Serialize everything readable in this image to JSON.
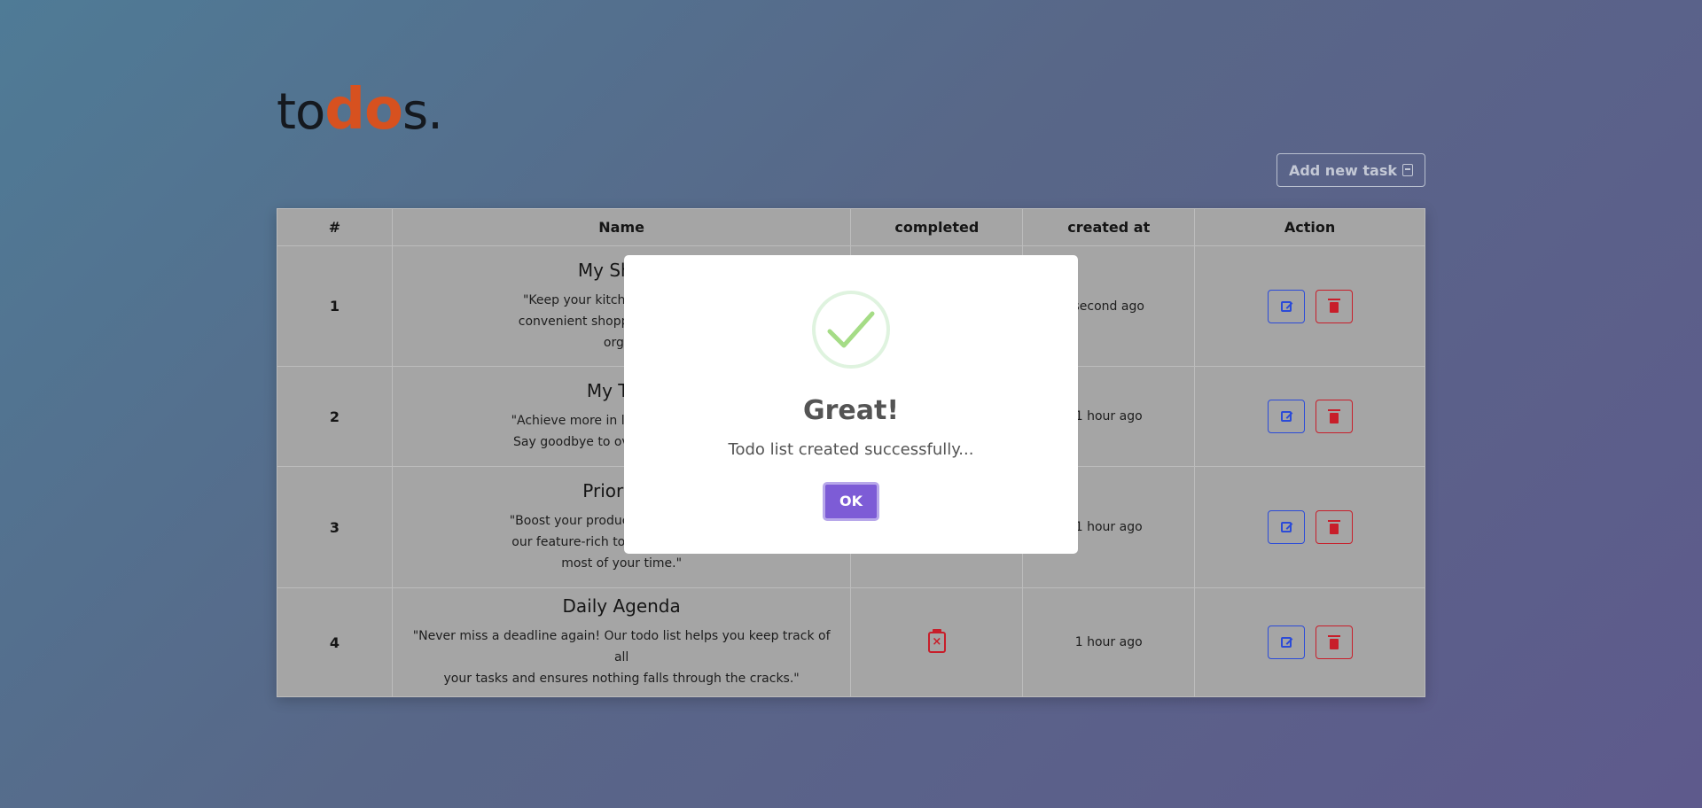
{
  "logo": {
    "part1": "to",
    "part2": "do",
    "part3": "s."
  },
  "toolbar": {
    "add_task_label": "Add new task"
  },
  "table": {
    "headers": [
      "#",
      "Name",
      "completed",
      "created at",
      "Action"
    ],
    "rows": [
      {
        "num": "1",
        "title": "My Shopp",
        "desc_lines": [
          "\"Keep your kitchen stocked and",
          "convenient shopping list app. Sin",
          "organ"
        ],
        "created": "second ago"
      },
      {
        "num": "2",
        "title": "My Task",
        "desc_lines": [
          "\"Achieve more in less time with our",
          "Say goodbye to overwhelm and he"
        ],
        "created": "1 hour ago"
      },
      {
        "num": "3",
        "title": "Prioritize",
        "desc_lines": [
          "\"Boost your productivity and stay fo",
          "our feature-rich todo list. Manage y",
          "most of your time.\""
        ],
        "created": "1 hour ago"
      },
      {
        "num": "4",
        "title": "Daily Agenda",
        "desc_lines": [
          "\"Never miss a deadline again! Our todo list helps you keep track of all",
          "your tasks and ensures nothing falls through the cracks.\""
        ],
        "created": "1 hour ago"
      }
    ]
  },
  "modal": {
    "icon": "success-check-icon",
    "title": "Great!",
    "message": "Todo list created successfully...",
    "ok_label": "OK"
  },
  "colors": {
    "brand_accent": "#d7511f",
    "edit": "#2b4bd8",
    "delete": "#c81e2a",
    "ok_button": "#7d5cd6",
    "success": "#a5dc86"
  }
}
